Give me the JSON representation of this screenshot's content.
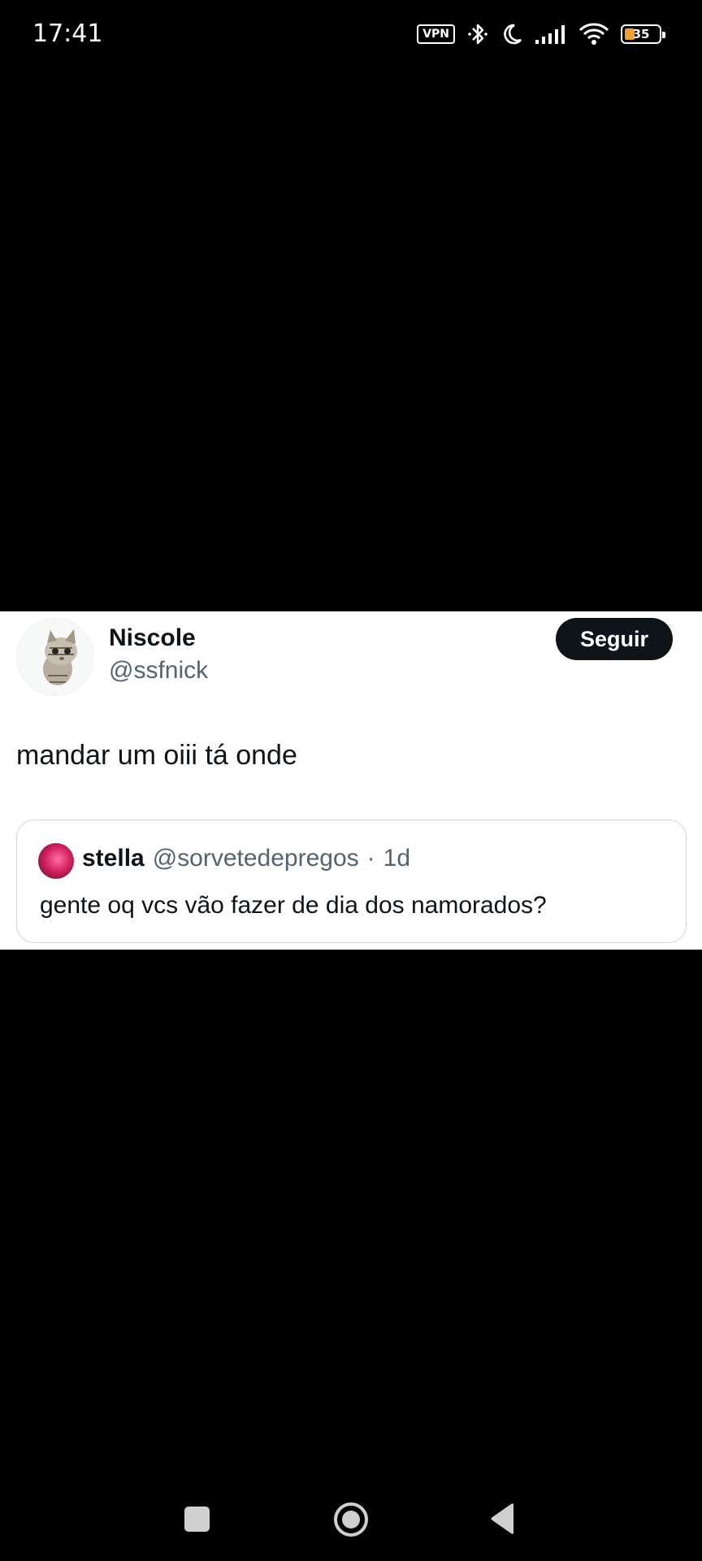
{
  "status_bar": {
    "time": "17:41",
    "vpn_label": "VPN",
    "battery_level": "35",
    "icons": [
      "vpn-icon",
      "bluetooth-icon",
      "do-not-disturb-moon-icon",
      "signal-icon",
      "wifi-icon",
      "battery-icon"
    ]
  },
  "tweet": {
    "display_name": "Niscole",
    "handle": "@ssfnick",
    "follow_label": "Seguir",
    "text": "mandar um oiii tá onde",
    "quote": {
      "display_name": "stella",
      "handle": "@sorvetedepregos",
      "separator": "·",
      "time": "1d",
      "text": "gente oq vcs vão fazer de dia dos namorados?"
    }
  },
  "nav_bar": {
    "buttons": [
      "recent-apps-button",
      "home-button",
      "back-button"
    ]
  },
  "colors": {
    "background": "#000000",
    "card": "#ffffff",
    "primary_text": "#0f1419",
    "secondary_text": "#536471",
    "follow_button": "#0f1419",
    "quote_border": "#cfd9de",
    "battery_accent": "#f0a030"
  }
}
